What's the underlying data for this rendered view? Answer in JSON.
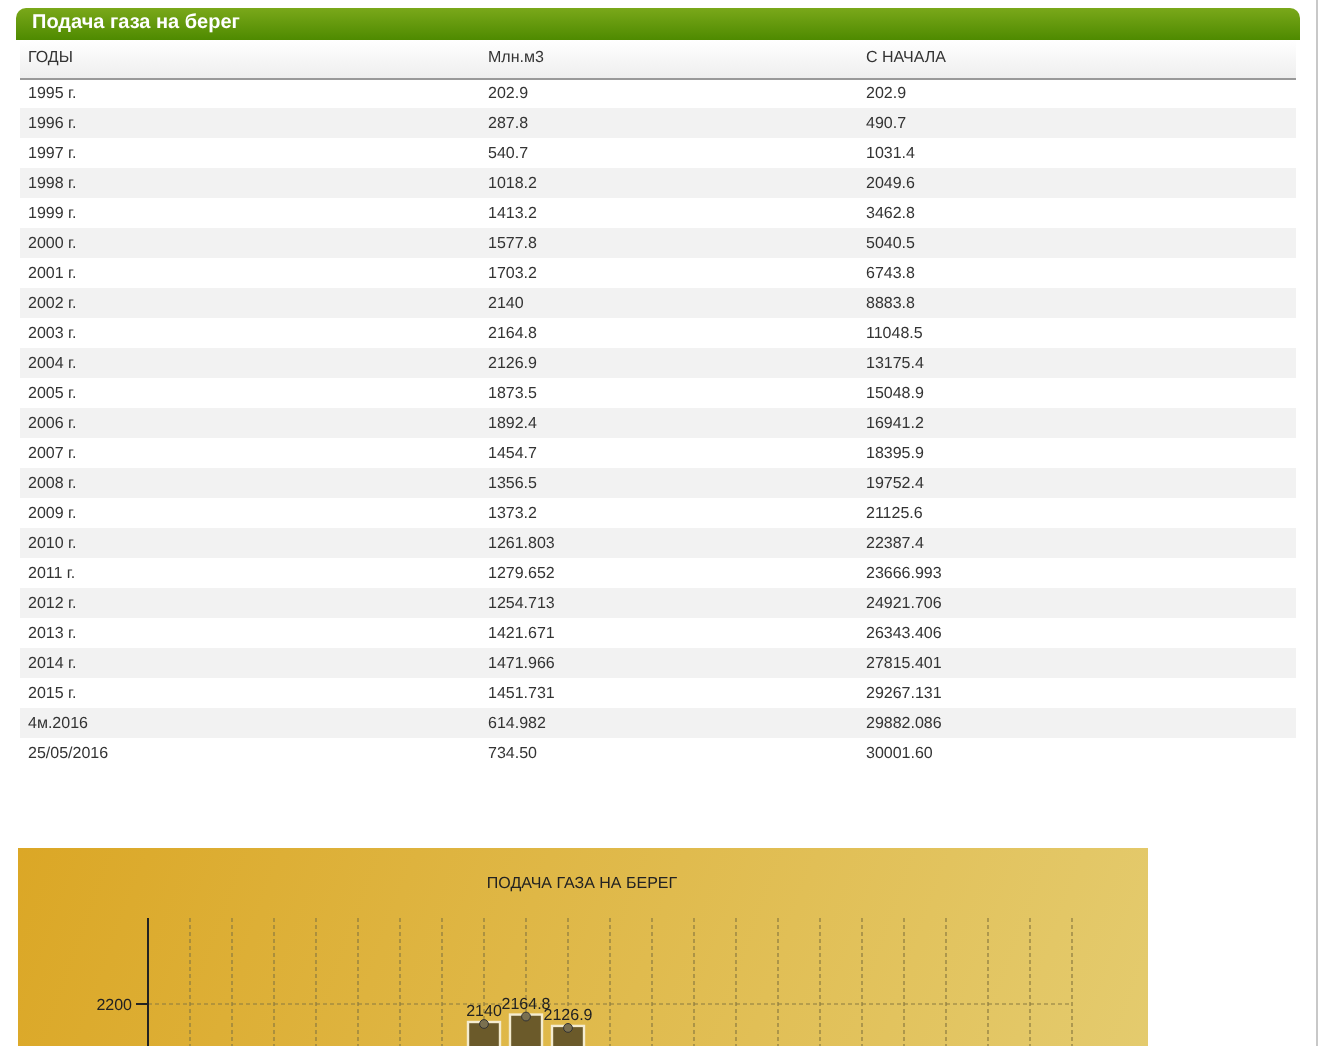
{
  "panel": {
    "title": "Подача газа на берег"
  },
  "table": {
    "columns": [
      "ГОДЫ",
      "Млн.м3",
      "С НАЧАЛА"
    ],
    "rows": [
      [
        "1995 г.",
        "202.9",
        "202.9"
      ],
      [
        "1996 г.",
        "287.8",
        "490.7"
      ],
      [
        "1997 г.",
        "540.7",
        "1031.4"
      ],
      [
        "1998 г.",
        "1018.2",
        "2049.6"
      ],
      [
        "1999 г.",
        "1413.2",
        "3462.8"
      ],
      [
        "2000 г.",
        "1577.8",
        "5040.5"
      ],
      [
        "2001 г.",
        "1703.2",
        "6743.8"
      ],
      [
        "2002 г.",
        "2140",
        "8883.8"
      ],
      [
        "2003 г.",
        "2164.8",
        "11048.5"
      ],
      [
        "2004 г.",
        "2126.9",
        "13175.4"
      ],
      [
        "2005 г.",
        "1873.5",
        "15048.9"
      ],
      [
        "2006 г.",
        "1892.4",
        "16941.2"
      ],
      [
        "2007 г.",
        "1454.7",
        "18395.9"
      ],
      [
        "2008 г.",
        "1356.5",
        "19752.4"
      ],
      [
        "2009 г.",
        "1373.2",
        "21125.6"
      ],
      [
        "2010 г.",
        "1261.803",
        "22387.4"
      ],
      [
        "2011 г.",
        "1279.652",
        "23666.993"
      ],
      [
        "2012 г.",
        "1254.713",
        "24921.706"
      ],
      [
        "2013 г.",
        "1421.671",
        "26343.406"
      ],
      [
        "2014 г.",
        "1471.966",
        "27815.401"
      ],
      [
        "2015 г.",
        "1451.731",
        "29267.131"
      ],
      [
        "4м.2016",
        "614.982",
        "29882.086"
      ],
      [
        "25/05/2016",
        "734.50",
        "30001.60"
      ]
    ]
  },
  "chart": {
    "title": "ПОДАЧА ГАЗА НА БЕРЕГ",
    "axis_label": "2200",
    "bar_labels": [
      "2140",
      "2164.8",
      "2126.9"
    ]
  }
}
